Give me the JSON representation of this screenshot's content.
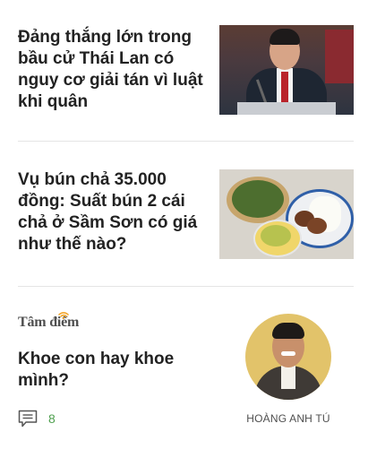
{
  "articles": [
    {
      "title": "Đảng thắng lớn trong bầu cử Thái Lan có nguy cơ giải tán vì luật khi quân",
      "thumbnail": "politician-at-podium-photo"
    },
    {
      "title": "Vụ bún chả 35.000 đồng: Suất bún 2 cái chả ở Sầm Sơn có giá như thế nào?",
      "thumbnail": "bun-cha-meal-photo"
    }
  ],
  "opinion": {
    "section_label": "Tâm điểm",
    "title": "Khoe con hay khoe mình?",
    "comment_count": "8",
    "author": "HOÀNG ANH TÚ",
    "colors": {
      "accent": "#F4A52A",
      "comment": "#4FA04F"
    }
  }
}
